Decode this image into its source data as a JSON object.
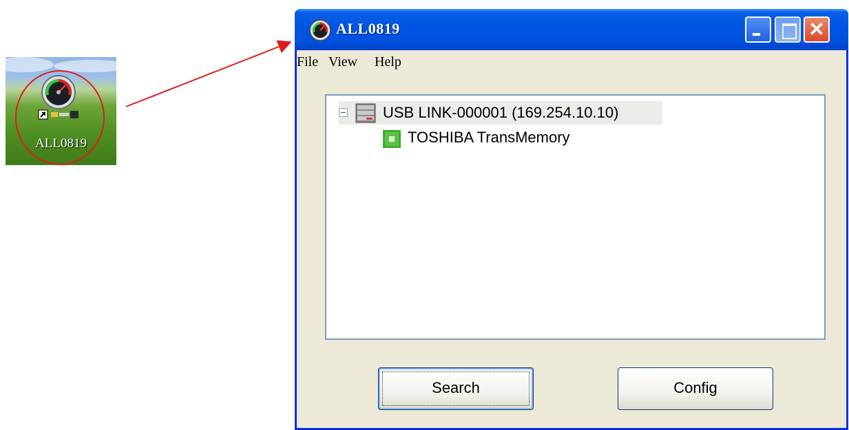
{
  "desktop": {
    "shortcut_label": "ALL0819",
    "shortcut_icon": "gauge-network-icon",
    "annotation_color": "#e31b1b"
  },
  "window": {
    "title": "ALL0819",
    "title_icon": "gauge-network-icon",
    "controls": [
      "minimize",
      "maximize",
      "close"
    ],
    "menu": {
      "file": "File",
      "view": "View",
      "help": "Help"
    },
    "tree": {
      "root_label": "USB LINK-000001 (169.254.10.10)",
      "root_icon": "server-icon",
      "root_expanded": true,
      "children": [
        {
          "label": "TOSHIBA TransMemory",
          "icon": "usb-storage-icon"
        }
      ]
    },
    "buttons": {
      "search": "Search",
      "config": "Config"
    },
    "colors": {
      "titlebar": "#0054e3",
      "window_bg": "#ece9d8",
      "close_btn": "#d9492a"
    }
  }
}
